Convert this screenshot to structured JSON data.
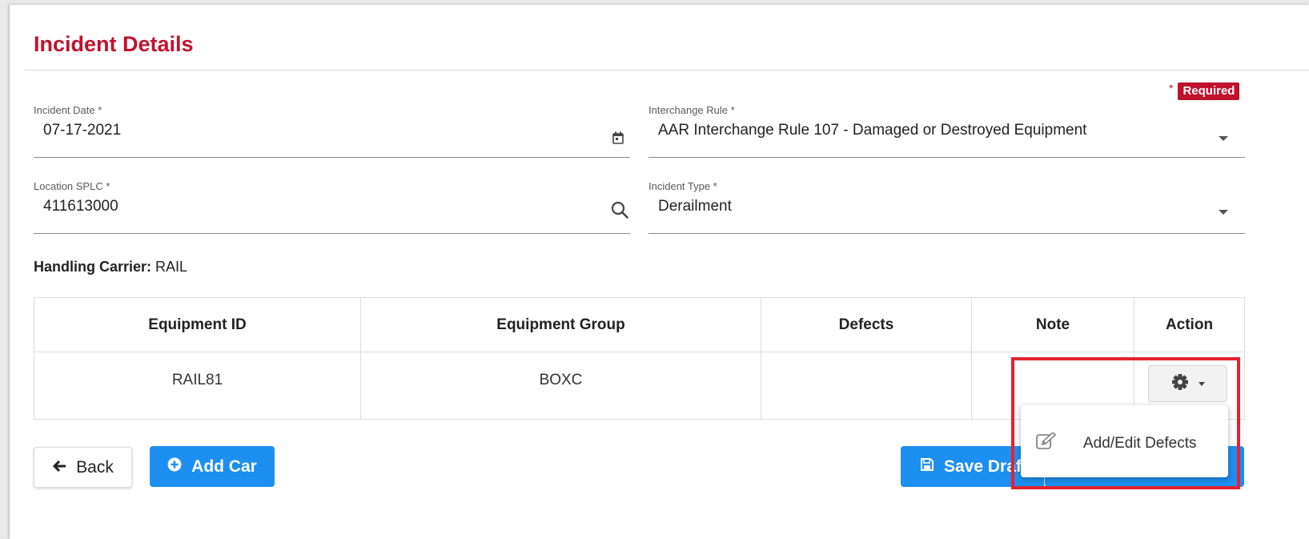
{
  "page": {
    "title": "Incident Details"
  },
  "required": {
    "star": "*",
    "label": "Required"
  },
  "fields": {
    "incident_date": {
      "label": "Incident Date *",
      "value": "07-17-2021",
      "icon": "calendar-icon"
    },
    "interchange_rule": {
      "label": "Interchange Rule *",
      "value": "AAR Interchange Rule 107 - Damaged or Destroyed Equipment",
      "icon": "chevron-down-icon"
    },
    "location_splc": {
      "label": "Location SPLC *",
      "value": "411613000",
      "icon": "search-icon"
    },
    "incident_type": {
      "label": "Incident Type *",
      "value": "Derailment",
      "icon": "chevron-down-icon"
    }
  },
  "handling_carrier": {
    "label": "Handling Carrier:",
    "value": "RAIL"
  },
  "table": {
    "columns": [
      "Equipment ID",
      "Equipment Group",
      "Defects",
      "Note",
      "Action"
    ],
    "rows": [
      {
        "equipment_id": "RAIL81",
        "equipment_group": "BOXC",
        "defects": "",
        "note": ""
      }
    ]
  },
  "action_menu": {
    "trigger_icon": "gear-icon",
    "items": [
      {
        "label": "Add/Edit Defects",
        "icon": "edit-icon"
      }
    ]
  },
  "buttons": {
    "back": {
      "label": "Back",
      "icon": "arrow-left-icon"
    },
    "add_car": {
      "label": "Add Car",
      "icon": "plus-circle-icon"
    },
    "save_draft": {
      "label": "Save Draft",
      "icon": "save-icon"
    }
  },
  "colors": {
    "accent_red": "#c0122c",
    "primary_blue": "#1d8ff0",
    "highlight_red": "#e5222f"
  }
}
